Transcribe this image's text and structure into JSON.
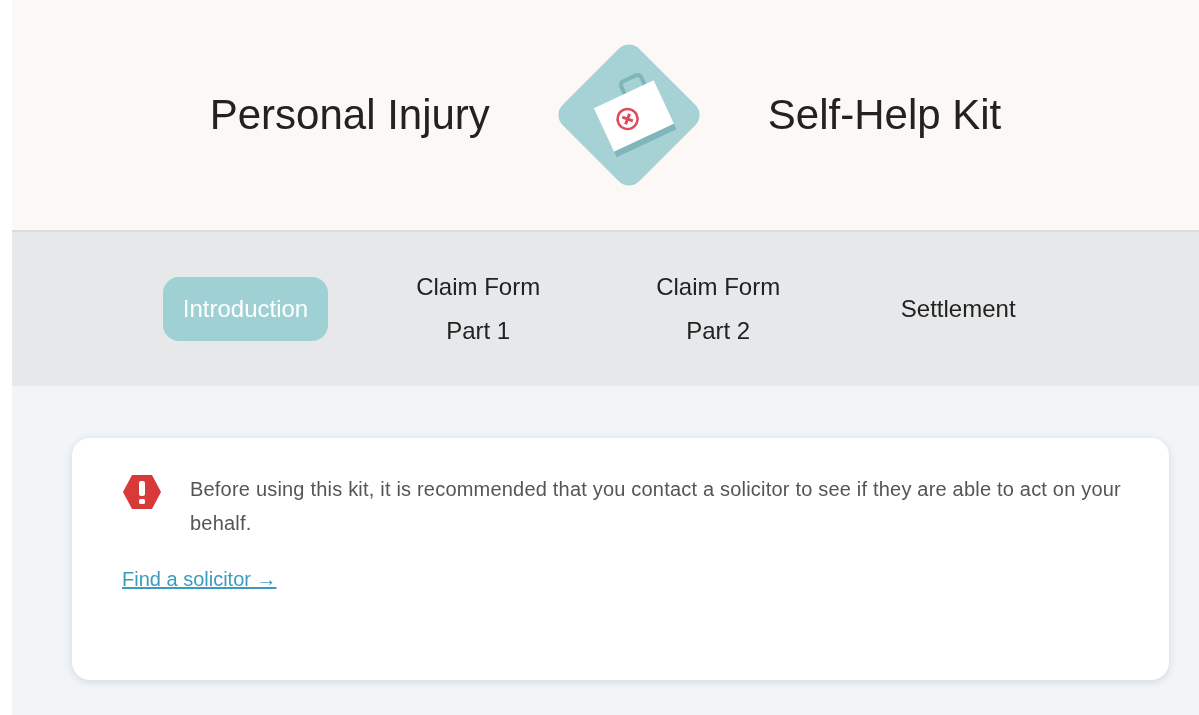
{
  "header": {
    "title_left": "Personal Injury",
    "title_right": "Self-Help Kit"
  },
  "tabs": [
    {
      "label": "Introduction",
      "selected": true
    },
    {
      "label": "Claim Form Part 1",
      "selected": false
    },
    {
      "label": "Claim Form Part 2",
      "selected": false
    },
    {
      "label": "Settlement",
      "selected": false
    }
  ],
  "notice": {
    "text": "Before using this kit, it is recommended that you contact a solicitor to see if they are able to act on your behalf.",
    "link": "Find a solicitor →"
  }
}
